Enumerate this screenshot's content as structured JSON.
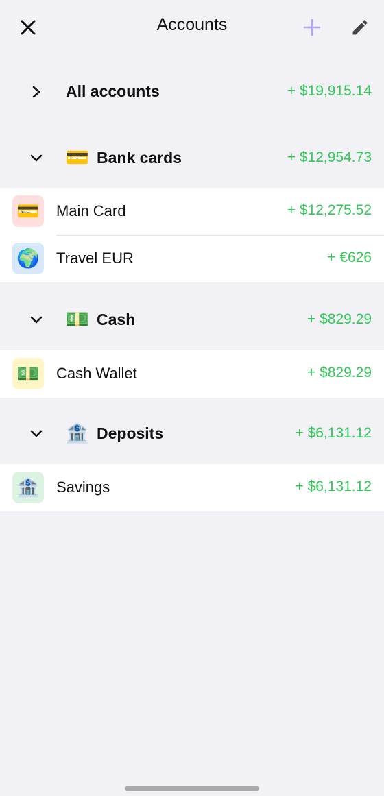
{
  "header": {
    "title": "Accounts",
    "close_icon": "close-icon",
    "add_icon": "plus-icon",
    "edit_icon": "pencil-icon",
    "accent_color": "#b3a6f5"
  },
  "all_accounts": {
    "label": "All accounts",
    "amount": "+ $19,915.14"
  },
  "groups": [
    {
      "label": "Bank cards",
      "emoji": "💳",
      "amount": "+ $12,954.73",
      "items": [
        {
          "label": "Main Card",
          "emoji": "💳",
          "amount": "+ $12,275.52",
          "icon_bg": "#ffdede"
        },
        {
          "label": "Travel EUR",
          "emoji": "🌍",
          "amount": "+ €626",
          "icon_bg": "#d8e8fb"
        }
      ]
    },
    {
      "label": "Cash",
      "emoji": "💵",
      "amount": "+ $829.29",
      "items": [
        {
          "label": "Cash Wallet",
          "emoji": "💵",
          "amount": "+ $829.29",
          "icon_bg": "#fff6c8"
        }
      ]
    },
    {
      "label": "Deposits",
      "emoji": "🏦",
      "amount": "+ $6,131.12",
      "items": [
        {
          "label": "Savings",
          "emoji": "🏦",
          "amount": "+ $6,131.12",
          "icon_bg": "#dcf3e2"
        }
      ]
    }
  ],
  "colors": {
    "positive": "#34c759",
    "background": "#f2f1f6",
    "card": "#ffffff"
  }
}
